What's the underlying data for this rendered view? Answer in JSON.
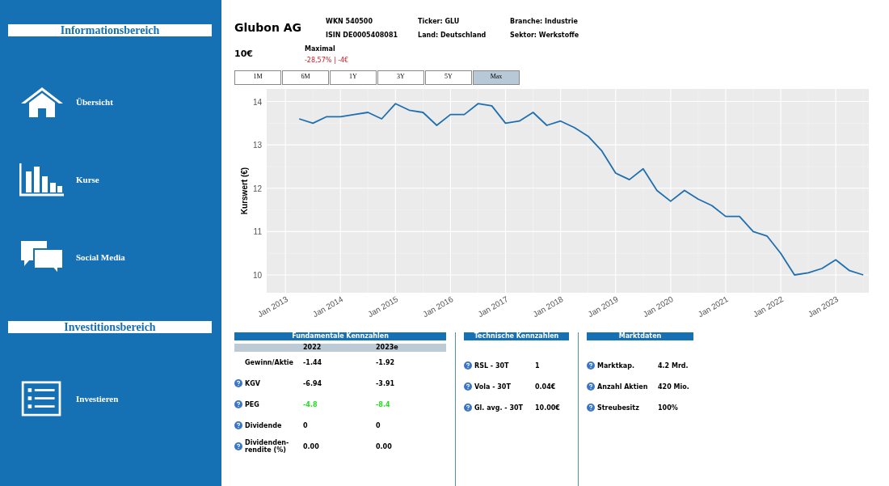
{
  "sidebar": {
    "sections": [
      {
        "title": "Informationsbereich",
        "items": [
          {
            "label": "Übersicht",
            "kind": "home"
          },
          {
            "label": "Kurse",
            "kind": "chart"
          },
          {
            "label": "Social Media",
            "kind": "chat"
          }
        ]
      },
      {
        "title": "Investitionsbereich",
        "items": [
          {
            "label": "Investieren",
            "kind": "list"
          }
        ]
      }
    ]
  },
  "header": {
    "company": "Glubon AG",
    "info": [
      "WKN 540500",
      "Ticker: GLU",
      "Branche: Industrie",
      "ISIN DE0005408081",
      "Land: Deutschland",
      "Sektor: Werkstoffe"
    ],
    "price": "10€",
    "period_label": "Maximal",
    "change": "-28,57% | -4€"
  },
  "range_tabs": [
    {
      "label": "1M",
      "selected": false
    },
    {
      "label": "6M",
      "selected": false
    },
    {
      "label": "1Y",
      "selected": false
    },
    {
      "label": "3Y",
      "selected": false
    },
    {
      "label": "5Y",
      "selected": false
    },
    {
      "label": "Max",
      "selected": true
    }
  ],
  "chart": {
    "chart_data": {
      "type": "line",
      "grid": true,
      "ylabel": "Kurswert (€)",
      "ylim": [
        9.59,
        14.29
      ],
      "yticks": [
        10,
        11,
        12,
        13,
        14
      ],
      "categories": [
        "Jan 2013",
        null,
        null,
        null,
        "Jan 2014",
        null,
        null,
        null,
        "Jan 2015",
        null,
        null,
        null,
        "Jan 2016",
        null,
        null,
        null,
        "Jan 2017",
        null,
        null,
        null,
        "Jan 2018",
        null,
        null,
        null,
        "Jan 2019",
        null,
        null,
        null,
        "Jan 2020",
        null,
        null,
        null,
        "Jan 2021",
        null,
        null,
        null,
        "Jan 2022",
        null,
        null,
        null,
        "Jan 2023",
        null,
        null
      ],
      "series": [
        {
          "color": "#1f6fb0",
          "values": [
            null,
            13.6,
            13.5,
            13.65,
            13.65,
            13.7,
            13.75,
            13.6,
            13.95,
            13.8,
            13.75,
            13.45,
            13.7,
            13.7,
            13.95,
            13.9,
            13.5,
            13.55,
            13.75,
            13.45,
            13.55,
            13.4,
            13.2,
            12.86,
            12.35,
            12.2,
            12.45,
            11.95,
            11.7,
            11.95,
            11.75,
            11.6,
            11.35,
            11.35,
            11.0,
            10.9,
            10.5,
            10.0,
            10.05,
            10.15,
            10.35,
            10.1,
            10.0
          ]
        }
      ]
    }
  },
  "fundamentals": {
    "title": "Fundamentale Kennzahlen",
    "columns": [
      "2022",
      "2023e"
    ],
    "rows": [
      {
        "label": "Gewinn/Aktie",
        "help": false,
        "positive": false,
        "values": [
          "-1.44",
          "-1.92"
        ]
      },
      {
        "label": "KGV",
        "help": true,
        "positive": false,
        "values": [
          "-6.94",
          "-3.91"
        ]
      },
      {
        "label": "PEG",
        "help": true,
        "positive": true,
        "values": [
          "-4.8",
          "-8.4"
        ]
      },
      {
        "label": "Dividende",
        "help": true,
        "positive": false,
        "values": [
          "0",
          "0"
        ]
      },
      {
        "label": "Dividenden-rendite (%)",
        "help": true,
        "positive": false,
        "values": [
          "0.00",
          "0.00"
        ]
      }
    ]
  },
  "technical": {
    "title": "Technische Kennzahlen",
    "rows": [
      {
        "label": "RSL - 30T",
        "value": "1"
      },
      {
        "label": "Vola - 30T",
        "value": "0.04€"
      },
      {
        "label": "Gl. avg. - 30T",
        "value": "10.00€"
      }
    ]
  },
  "market": {
    "title": "Marktdaten",
    "rows": [
      {
        "label": "Marktkap.",
        "value": "4.2 Mrd."
      },
      {
        "label": "Anzahl Aktien",
        "value": "420 Mio."
      },
      {
        "label": "Streubesitz",
        "value": "100%"
      }
    ]
  }
}
